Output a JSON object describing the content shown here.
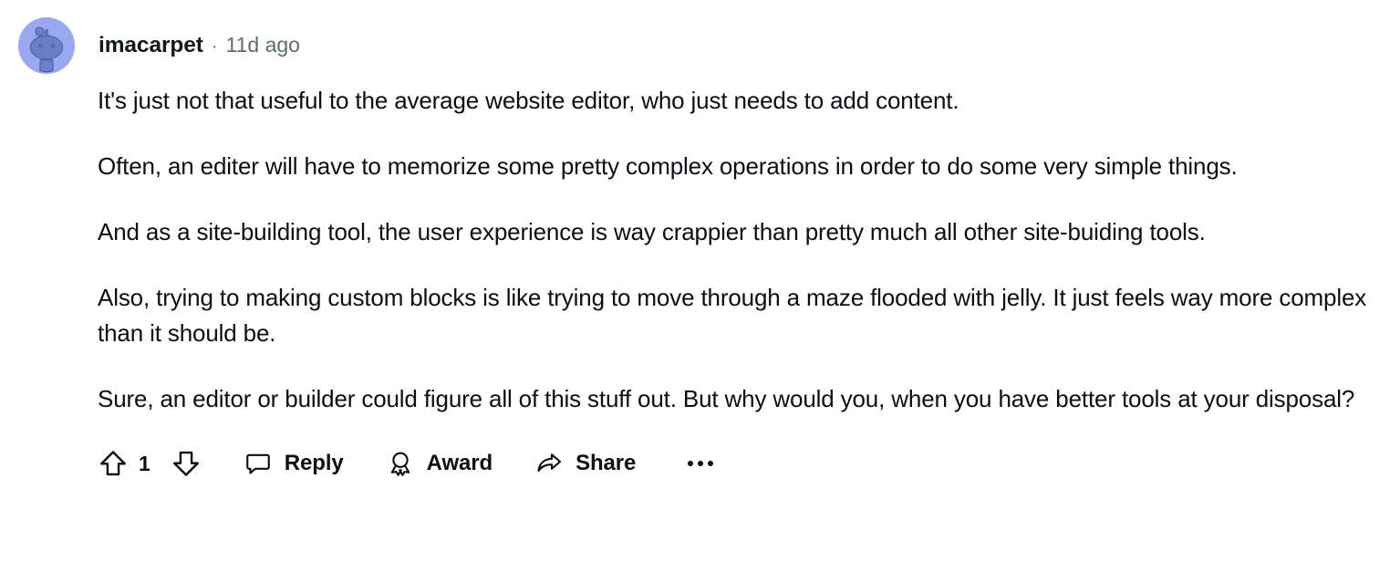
{
  "comment": {
    "author": "imacarpet",
    "separator": "·",
    "timestamp": "11d ago",
    "avatar": {
      "icon": "reddit-snoo-avatar",
      "background_color": "#9aa8f2",
      "figure_color": "#6b7fc9"
    },
    "paragraphs": [
      "It's just not that useful to the average website editor, who just needs to add content.",
      "Often, an editer will have to memorize some pretty complex operations in order to do some very simple things.",
      "And as a site-building tool, the user experience is way crappier than pretty much all other site-buiding tools.",
      "Also, trying to making custom blocks is like trying to move through a maze flooded with jelly. It just feels way more complex than it should be.",
      "Sure, an editor or builder could figure all of this stuff out. But why would you, when you have better tools at your disposal?"
    ]
  },
  "actions": {
    "upvote": {
      "icon": "upvote-arrow-icon",
      "label": "Upvote"
    },
    "vote_count": "1",
    "downvote": {
      "icon": "downvote-arrow-icon",
      "label": "Downvote"
    },
    "reply": {
      "icon": "comment-bubble-icon",
      "label": "Reply"
    },
    "award": {
      "icon": "award-ribbon-icon",
      "label": "Award"
    },
    "share": {
      "icon": "share-arrow-icon",
      "label": "Share"
    },
    "more": {
      "icon": "ellipsis-icon",
      "label": "More options"
    }
  },
  "colors": {
    "text_primary": "#0b0f12",
    "text_muted": "#5c6c74",
    "background": "#ffffff"
  }
}
